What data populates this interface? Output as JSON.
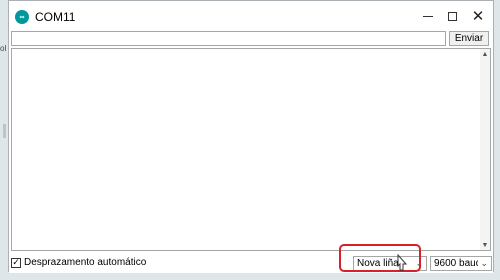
{
  "window": {
    "title": "COM11",
    "app_icon_glyph": "∞",
    "controls": {
      "minimize_icon": "minimize-icon",
      "maximize_icon": "maximize-icon",
      "close_glyph": "✕"
    }
  },
  "send": {
    "input_value": "",
    "button_label": "Enviar"
  },
  "output": {
    "text": ""
  },
  "background": {
    "left_fragment": "ol"
  },
  "bottom": {
    "autoscroll_label": "Desprazamento automático",
    "autoscroll_checked": true,
    "line_ending": "Nova liña",
    "baud_rate": "9600 baudio"
  },
  "colors": {
    "highlight": "#d6202a",
    "app_icon": "#00979c"
  }
}
